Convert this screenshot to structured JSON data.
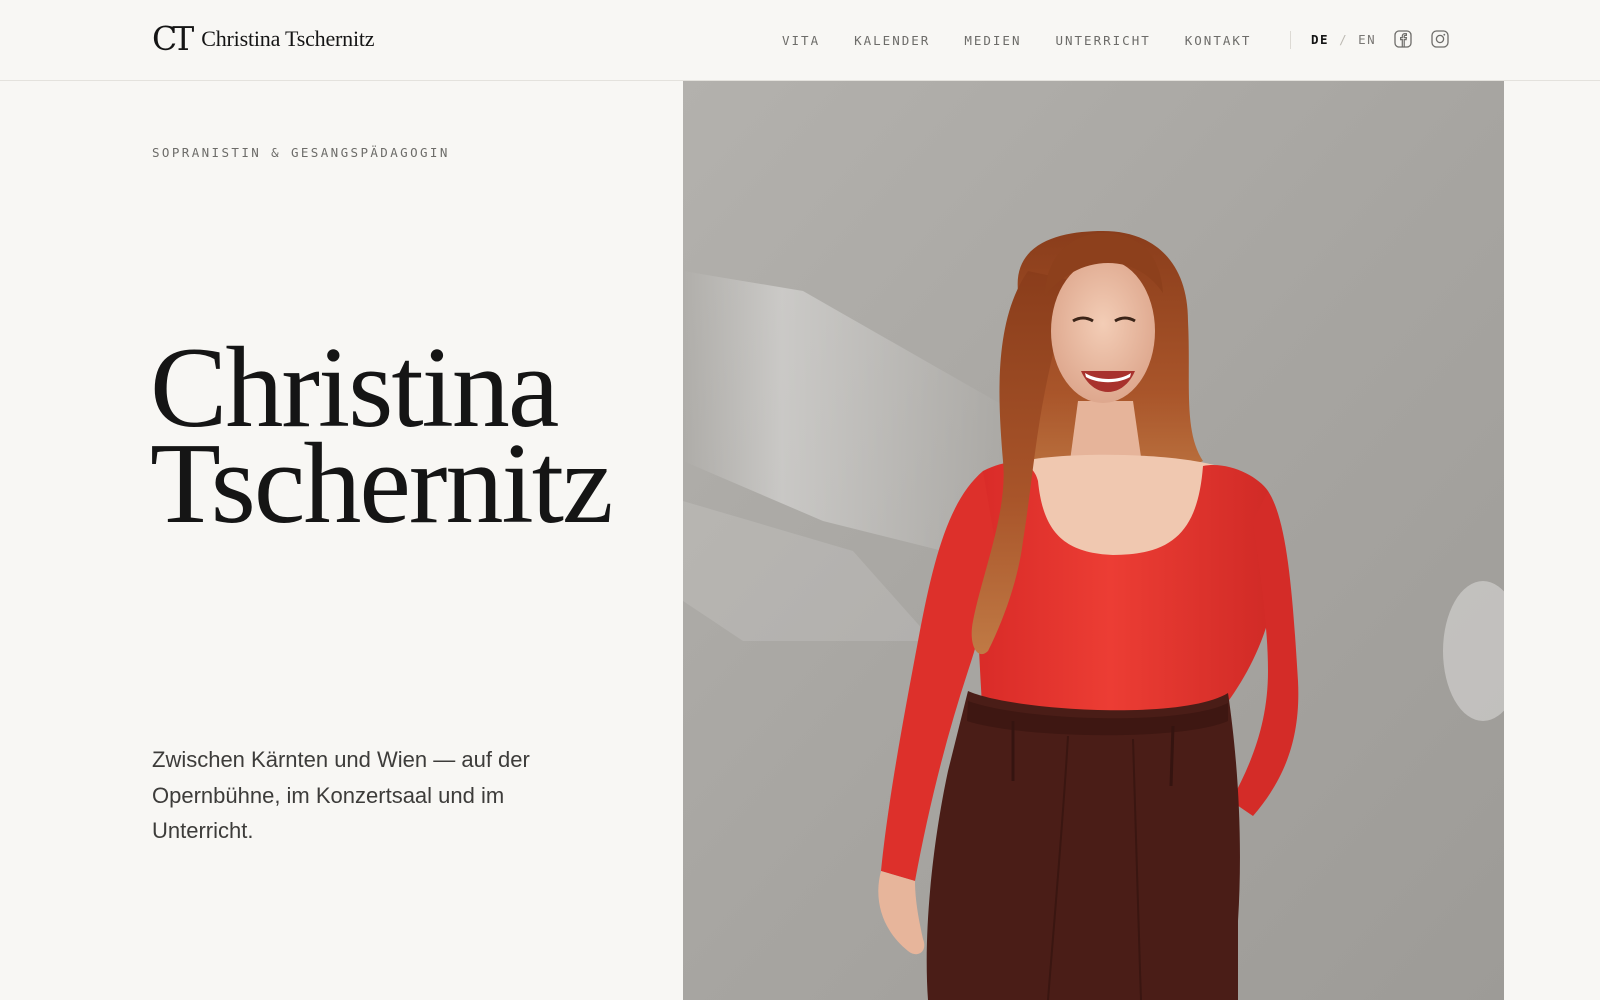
{
  "header": {
    "logo_mark": "CT",
    "logo_name": "Christina Tschernitz",
    "nav": [
      {
        "label": "VITA"
      },
      {
        "label": "KALENDER"
      },
      {
        "label": "MEDIEN"
      },
      {
        "label": "UNTERRICHT"
      },
      {
        "label": "KONTAKT"
      }
    ],
    "lang": {
      "active": "DE",
      "separator": "/",
      "inactive": "EN"
    },
    "social": [
      "facebook-icon",
      "instagram-icon"
    ]
  },
  "hero": {
    "eyebrow": "SOPRANISTIN & GESANGSPÄDAGOGIN",
    "title_line1": "Christina",
    "title_line2": "Tschernitz",
    "lead": "Zwischen Kärnten und Wien — auf der Opernbühne, im Konzertsaal und im Unterricht."
  },
  "colors": {
    "background": "#f8f7f4",
    "text": "#151515",
    "muted": "#6d6c69",
    "top": "#e8382f",
    "trousers": "#4a1d17",
    "hair": "#9c4a22",
    "wall": "#a8a6a2"
  }
}
